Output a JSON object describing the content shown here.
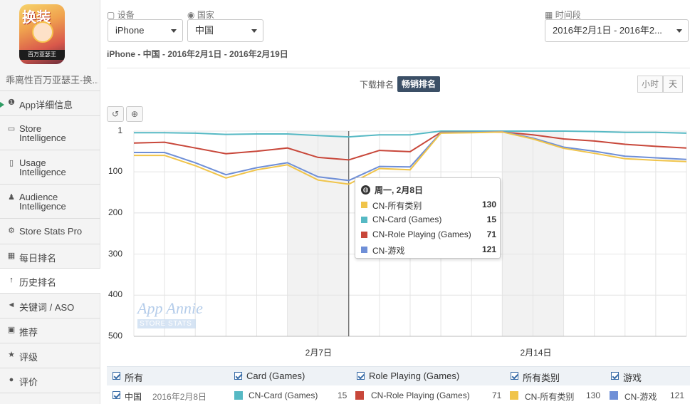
{
  "app": {
    "name": "乖离性百万亚瑟王-换...",
    "icon_text_top": "换装",
    "icon_text_band": "百万亚瑟王"
  },
  "sidebar": {
    "items": [
      {
        "label": "App详细信息",
        "icon": "info-icon"
      },
      {
        "label": "Store Intelligence",
        "icon": "store-icon"
      },
      {
        "label": "Usage Intelligence",
        "icon": "phone-icon"
      },
      {
        "label": "Audience Intelligence",
        "icon": "person-icon"
      },
      {
        "label": "Store Stats Pro",
        "icon": "gear-icon"
      },
      {
        "label": "每日排名",
        "icon": "calendar-icon"
      },
      {
        "label": "历史排名",
        "icon": "arrow-up-icon"
      },
      {
        "label": "关键词 / ASO",
        "icon": "megaphone-icon"
      },
      {
        "label": "推荐",
        "icon": "bookmark-icon"
      },
      {
        "label": "评级",
        "icon": "star-icon"
      },
      {
        "label": "评价",
        "icon": "comment-icon"
      }
    ]
  },
  "filters": {
    "device_label": "设备",
    "device_value": "iPhone",
    "country_label": "国家",
    "country_value": "中国",
    "period_label": "时间段",
    "period_value": "2016年2月1日 - 2016年2..."
  },
  "subtitle": "iPhone - 中国 - 2016年2月1日 - 2016年2月19日",
  "toggles": {
    "downloads": "下载排名",
    "grossing": "畅销排名",
    "hourly": "小时",
    "daily": "天"
  },
  "watermark": {
    "line1": "App Annie",
    "line2": "STORE STATS"
  },
  "chart_data": {
    "type": "line",
    "y_reversed": true,
    "ylim": [
      1,
      500
    ],
    "yticks": [
      "1",
      "100",
      "200",
      "300",
      "400",
      "500"
    ],
    "xtick_labels": [
      "2月7日",
      "2月14日"
    ],
    "x": [
      "2月1日",
      "2月2日",
      "2月3日",
      "2月4日",
      "2月5日",
      "2月6日",
      "2月7日",
      "2月8日",
      "2月9日",
      "2月10日",
      "2月11日",
      "2月12日",
      "2月13日",
      "2月14日",
      "2月15日",
      "2月16日",
      "2月17日",
      "2月18日",
      "2月19日"
    ],
    "series": [
      {
        "name": "CN-Card (Games)",
        "color": "#56b9c4",
        "values": [
          5,
          5,
          6,
          9,
          8,
          8,
          12,
          15,
          10,
          10,
          1,
          1,
          1,
          1,
          1,
          2,
          4,
          4,
          6
        ]
      },
      {
        "name": "CN-Role Playing (Games)",
        "color": "#c8473a",
        "values": [
          30,
          28,
          42,
          56,
          50,
          42,
          65,
          71,
          48,
          51,
          4,
          4,
          3,
          10,
          20,
          25,
          33,
          38,
          42
        ]
      },
      {
        "name": "CN-游戏",
        "color": "#6f8fd7",
        "values": [
          53,
          53,
          78,
          107,
          90,
          78,
          112,
          121,
          87,
          88,
          5,
          4,
          2,
          18,
          40,
          50,
          62,
          66,
          70
        ]
      },
      {
        "name": "CN-所有类别",
        "color": "#f0c44a",
        "values": [
          60,
          60,
          85,
          115,
          95,
          83,
          120,
          130,
          92,
          95,
          6,
          5,
          3,
          20,
          43,
          55,
          68,
          72,
          75
        ]
      }
    ]
  },
  "tooltip": {
    "date": "周一, 2月8日",
    "rows": [
      {
        "name": "CN-所有类别",
        "value": "130",
        "color": "#f0c44a"
      },
      {
        "name": "CN-Card (Games)",
        "value": "15",
        "color": "#56b9c4"
      },
      {
        "name": "CN-Role Playing (Games)",
        "value": "71",
        "color": "#c8473a"
      },
      {
        "name": "CN-游戏",
        "value": "121",
        "color": "#6f8fd7"
      }
    ]
  },
  "legend": {
    "all": "所有",
    "card": "Card (Games)",
    "rpg": "Role Playing (Games)",
    "allcat": "所有类别",
    "games": "游戏"
  },
  "detail": {
    "country": "中国",
    "date": "2016年2月8日",
    "card_name": "CN-Card (Games)",
    "card_value": "15",
    "card_color": "#56b9c4",
    "rpg_name": "CN-Role Playing (Games)",
    "rpg_value": "71",
    "rpg_color": "#c8473a",
    "allcat_name": "CN-所有类别",
    "allcat_value": "130",
    "allcat_color": "#f0c44a",
    "games_name": "CN-游戏",
    "games_value": "121",
    "games_color": "#6f8fd7"
  }
}
